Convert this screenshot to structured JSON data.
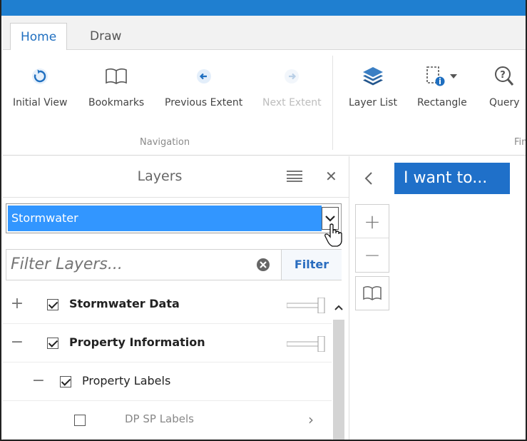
{
  "tabs": [
    {
      "label": "Home",
      "active": true
    },
    {
      "label": "Draw",
      "active": false
    }
  ],
  "ribbon": {
    "navigation": {
      "group_label": "Navigation",
      "buttons": [
        {
          "label": "Initial View",
          "icon": "refresh-icon",
          "enabled": true
        },
        {
          "label": "Bookmarks",
          "icon": "book-icon",
          "enabled": true
        },
        {
          "label": "Previous Extent",
          "icon": "arrow-left-icon",
          "enabled": true
        },
        {
          "label": "Next Extent",
          "icon": "arrow-right-icon",
          "enabled": false
        }
      ]
    },
    "find": {
      "group_label": "Fin",
      "buttons": [
        {
          "label": "Layer List",
          "icon": "layers-icon",
          "enabled": true
        },
        {
          "label": "Rectangle",
          "icon": "rectangle-info-icon",
          "enabled": true
        },
        {
          "label": "Query",
          "icon": "query-icon",
          "enabled": true
        }
      ]
    }
  },
  "layers_panel": {
    "title": "Layers",
    "theme_dropdown": {
      "selected": "Stormwater"
    },
    "filter": {
      "placeholder": "Filter Layers...",
      "button_label": "Filter"
    },
    "items": [
      {
        "label": "Stormwater Data",
        "expander": "+",
        "checked": true,
        "bold": true,
        "level": 0
      },
      {
        "label": "Property Information",
        "expander": "−",
        "checked": true,
        "bold": true,
        "level": 0
      },
      {
        "label": "Property Labels",
        "expander": "−",
        "checked": true,
        "bold": false,
        "level": 1
      },
      {
        "label": "DP SP Labels",
        "expander": "",
        "checked": false,
        "bold": false,
        "level": 2
      }
    ]
  },
  "map": {
    "i_want_to_label": "I want to...",
    "zoom_in": "+",
    "zoom_out": "−"
  },
  "colors": {
    "accent": "#1f70c9",
    "selection": "#3296ff",
    "titlebar": "#1f7fd0"
  }
}
